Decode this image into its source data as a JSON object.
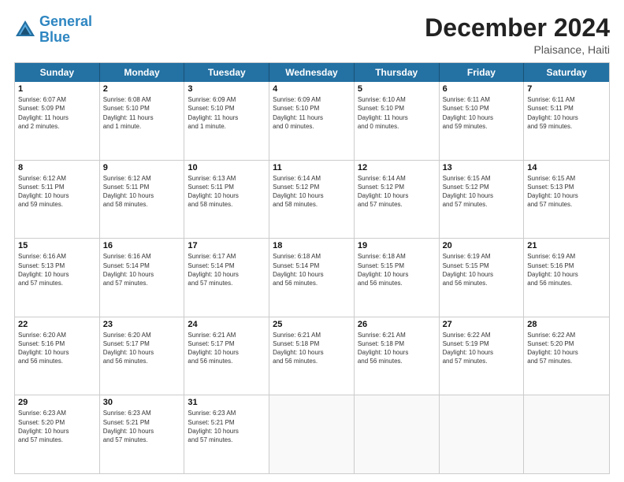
{
  "logo": {
    "line1": "General",
    "line2": "Blue"
  },
  "title": "December 2024",
  "subtitle": "Plaisance, Haiti",
  "days_of_week": [
    "Sunday",
    "Monday",
    "Tuesday",
    "Wednesday",
    "Thursday",
    "Friday",
    "Saturday"
  ],
  "weeks": [
    [
      {
        "day": "1",
        "lines": [
          "Sunrise: 6:07 AM",
          "Sunset: 5:09 PM",
          "Daylight: 11 hours",
          "and 2 minutes."
        ]
      },
      {
        "day": "2",
        "lines": [
          "Sunrise: 6:08 AM",
          "Sunset: 5:10 PM",
          "Daylight: 11 hours",
          "and 1 minute."
        ]
      },
      {
        "day": "3",
        "lines": [
          "Sunrise: 6:09 AM",
          "Sunset: 5:10 PM",
          "Daylight: 11 hours",
          "and 1 minute."
        ]
      },
      {
        "day": "4",
        "lines": [
          "Sunrise: 6:09 AM",
          "Sunset: 5:10 PM",
          "Daylight: 11 hours",
          "and 0 minutes."
        ]
      },
      {
        "day": "5",
        "lines": [
          "Sunrise: 6:10 AM",
          "Sunset: 5:10 PM",
          "Daylight: 11 hours",
          "and 0 minutes."
        ]
      },
      {
        "day": "6",
        "lines": [
          "Sunrise: 6:11 AM",
          "Sunset: 5:10 PM",
          "Daylight: 10 hours",
          "and 59 minutes."
        ]
      },
      {
        "day": "7",
        "lines": [
          "Sunrise: 6:11 AM",
          "Sunset: 5:11 PM",
          "Daylight: 10 hours",
          "and 59 minutes."
        ]
      }
    ],
    [
      {
        "day": "8",
        "lines": [
          "Sunrise: 6:12 AM",
          "Sunset: 5:11 PM",
          "Daylight: 10 hours",
          "and 59 minutes."
        ]
      },
      {
        "day": "9",
        "lines": [
          "Sunrise: 6:12 AM",
          "Sunset: 5:11 PM",
          "Daylight: 10 hours",
          "and 58 minutes."
        ]
      },
      {
        "day": "10",
        "lines": [
          "Sunrise: 6:13 AM",
          "Sunset: 5:11 PM",
          "Daylight: 10 hours",
          "and 58 minutes."
        ]
      },
      {
        "day": "11",
        "lines": [
          "Sunrise: 6:14 AM",
          "Sunset: 5:12 PM",
          "Daylight: 10 hours",
          "and 58 minutes."
        ]
      },
      {
        "day": "12",
        "lines": [
          "Sunrise: 6:14 AM",
          "Sunset: 5:12 PM",
          "Daylight: 10 hours",
          "and 57 minutes."
        ]
      },
      {
        "day": "13",
        "lines": [
          "Sunrise: 6:15 AM",
          "Sunset: 5:12 PM",
          "Daylight: 10 hours",
          "and 57 minutes."
        ]
      },
      {
        "day": "14",
        "lines": [
          "Sunrise: 6:15 AM",
          "Sunset: 5:13 PM",
          "Daylight: 10 hours",
          "and 57 minutes."
        ]
      }
    ],
    [
      {
        "day": "15",
        "lines": [
          "Sunrise: 6:16 AM",
          "Sunset: 5:13 PM",
          "Daylight: 10 hours",
          "and 57 minutes."
        ]
      },
      {
        "day": "16",
        "lines": [
          "Sunrise: 6:16 AM",
          "Sunset: 5:14 PM",
          "Daylight: 10 hours",
          "and 57 minutes."
        ]
      },
      {
        "day": "17",
        "lines": [
          "Sunrise: 6:17 AM",
          "Sunset: 5:14 PM",
          "Daylight: 10 hours",
          "and 57 minutes."
        ]
      },
      {
        "day": "18",
        "lines": [
          "Sunrise: 6:18 AM",
          "Sunset: 5:14 PM",
          "Daylight: 10 hours",
          "and 56 minutes."
        ]
      },
      {
        "day": "19",
        "lines": [
          "Sunrise: 6:18 AM",
          "Sunset: 5:15 PM",
          "Daylight: 10 hours",
          "and 56 minutes."
        ]
      },
      {
        "day": "20",
        "lines": [
          "Sunrise: 6:19 AM",
          "Sunset: 5:15 PM",
          "Daylight: 10 hours",
          "and 56 minutes."
        ]
      },
      {
        "day": "21",
        "lines": [
          "Sunrise: 6:19 AM",
          "Sunset: 5:16 PM",
          "Daylight: 10 hours",
          "and 56 minutes."
        ]
      }
    ],
    [
      {
        "day": "22",
        "lines": [
          "Sunrise: 6:20 AM",
          "Sunset: 5:16 PM",
          "Daylight: 10 hours",
          "and 56 minutes."
        ]
      },
      {
        "day": "23",
        "lines": [
          "Sunrise: 6:20 AM",
          "Sunset: 5:17 PM",
          "Daylight: 10 hours",
          "and 56 minutes."
        ]
      },
      {
        "day": "24",
        "lines": [
          "Sunrise: 6:21 AM",
          "Sunset: 5:17 PM",
          "Daylight: 10 hours",
          "and 56 minutes."
        ]
      },
      {
        "day": "25",
        "lines": [
          "Sunrise: 6:21 AM",
          "Sunset: 5:18 PM",
          "Daylight: 10 hours",
          "and 56 minutes."
        ]
      },
      {
        "day": "26",
        "lines": [
          "Sunrise: 6:21 AM",
          "Sunset: 5:18 PM",
          "Daylight: 10 hours",
          "and 56 minutes."
        ]
      },
      {
        "day": "27",
        "lines": [
          "Sunrise: 6:22 AM",
          "Sunset: 5:19 PM",
          "Daylight: 10 hours",
          "and 57 minutes."
        ]
      },
      {
        "day": "28",
        "lines": [
          "Sunrise: 6:22 AM",
          "Sunset: 5:20 PM",
          "Daylight: 10 hours",
          "and 57 minutes."
        ]
      }
    ],
    [
      {
        "day": "29",
        "lines": [
          "Sunrise: 6:23 AM",
          "Sunset: 5:20 PM",
          "Daylight: 10 hours",
          "and 57 minutes."
        ]
      },
      {
        "day": "30",
        "lines": [
          "Sunrise: 6:23 AM",
          "Sunset: 5:21 PM",
          "Daylight: 10 hours",
          "and 57 minutes."
        ]
      },
      {
        "day": "31",
        "lines": [
          "Sunrise: 6:23 AM",
          "Sunset: 5:21 PM",
          "Daylight: 10 hours",
          "and 57 minutes."
        ]
      },
      null,
      null,
      null,
      null
    ]
  ]
}
